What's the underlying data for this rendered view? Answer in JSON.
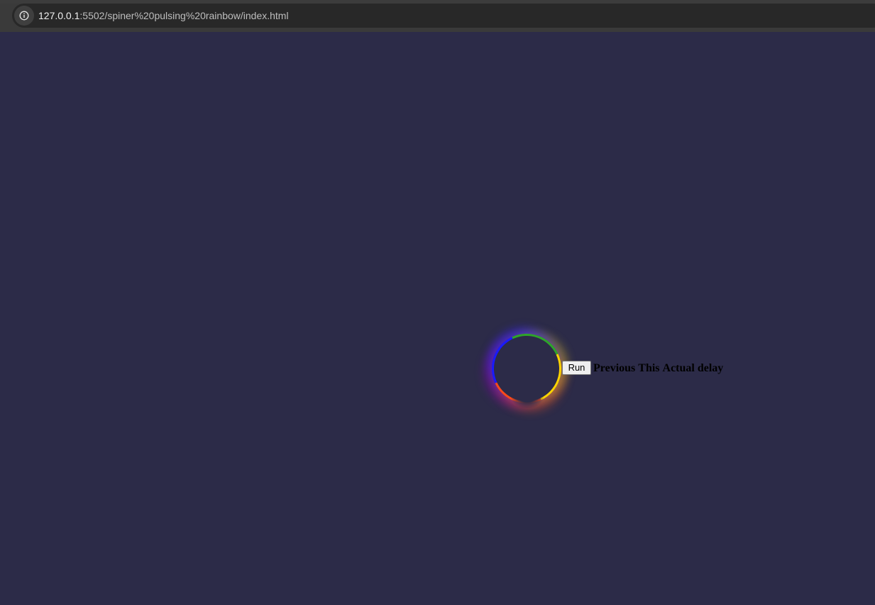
{
  "browser": {
    "url_host": "127.0.0.1",
    "url_rest": ":5502/spiner%20pulsing%20rainbow/index.html",
    "site_info_icon": "info-icon"
  },
  "page": {
    "background_color": "#2c2b48",
    "spinner": {
      "icon": "rainbow-ring-spinner",
      "colors": [
        "#2ea52a",
        "#ffd400",
        "#ff4a1a",
        "#1a1aff",
        "#9600c8"
      ]
    },
    "run_button_label": "Run",
    "status_words": [
      "Previous",
      "This",
      "Actual",
      "delay"
    ]
  }
}
